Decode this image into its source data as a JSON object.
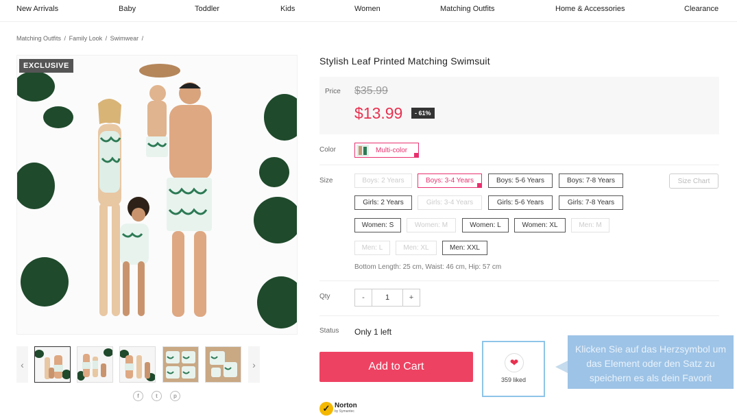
{
  "nav": [
    "New Arrivals",
    "Baby",
    "Toddler",
    "Kids",
    "Women",
    "Matching Outfits",
    "Home & Accessories",
    "Clearance"
  ],
  "breadcrumb": [
    "Matching Outfits",
    "/",
    "Family Look",
    "/",
    "Swimwear",
    "/"
  ],
  "badge": "EXCLUSIVE",
  "product": {
    "title": "Stylish Leaf Printed Matching Swimsuit",
    "price_label": "Price",
    "old_price": "$35.99",
    "new_price": "$13.99",
    "discount": "- 61%",
    "color_label": "Color",
    "color_value": "Multi-color",
    "size_label": "Size",
    "size_chart": "Size Chart",
    "sizes": [
      [
        "Boys: 2 Years",
        "Boys: 3-4 Years",
        "Boys: 5-6 Years",
        "Boys: 7-8 Years"
      ],
      [
        "Girls: 2 Years",
        "Girls: 3-4 Years",
        "Girls: 5-6 Years",
        "Girls: 7-8 Years"
      ],
      [
        "Women: S",
        "Women: M",
        "Women: L",
        "Women: XL",
        "Men: M"
      ],
      [
        "Men: L",
        "Men: XL",
        "Men: XXL"
      ]
    ],
    "measurements": "Bottom Length: 25 cm, Waist: 46 cm, Hip: 57 cm",
    "qty_label": "Qty",
    "qty_minus": "-",
    "qty_value": "1",
    "qty_plus": "+",
    "status_label": "Status",
    "status_value": "Only 1 left",
    "add_to_cart": "Add to Cart",
    "liked": "359 liked"
  },
  "tooltip": "Klicken Sie auf das Herzsymbol um das Element oder den Satz zu speichern es als dein Favorit",
  "norton": {
    "name": "Norton",
    "sub": "by Symantec"
  },
  "thumb_arrows": {
    "prev": "‹",
    "next": "›"
  },
  "social": [
    "f",
    "t",
    "p"
  ],
  "colors": {
    "accent": "#e8304f",
    "cart": "#ee4262",
    "tooltip": "#9dc3e6"
  }
}
